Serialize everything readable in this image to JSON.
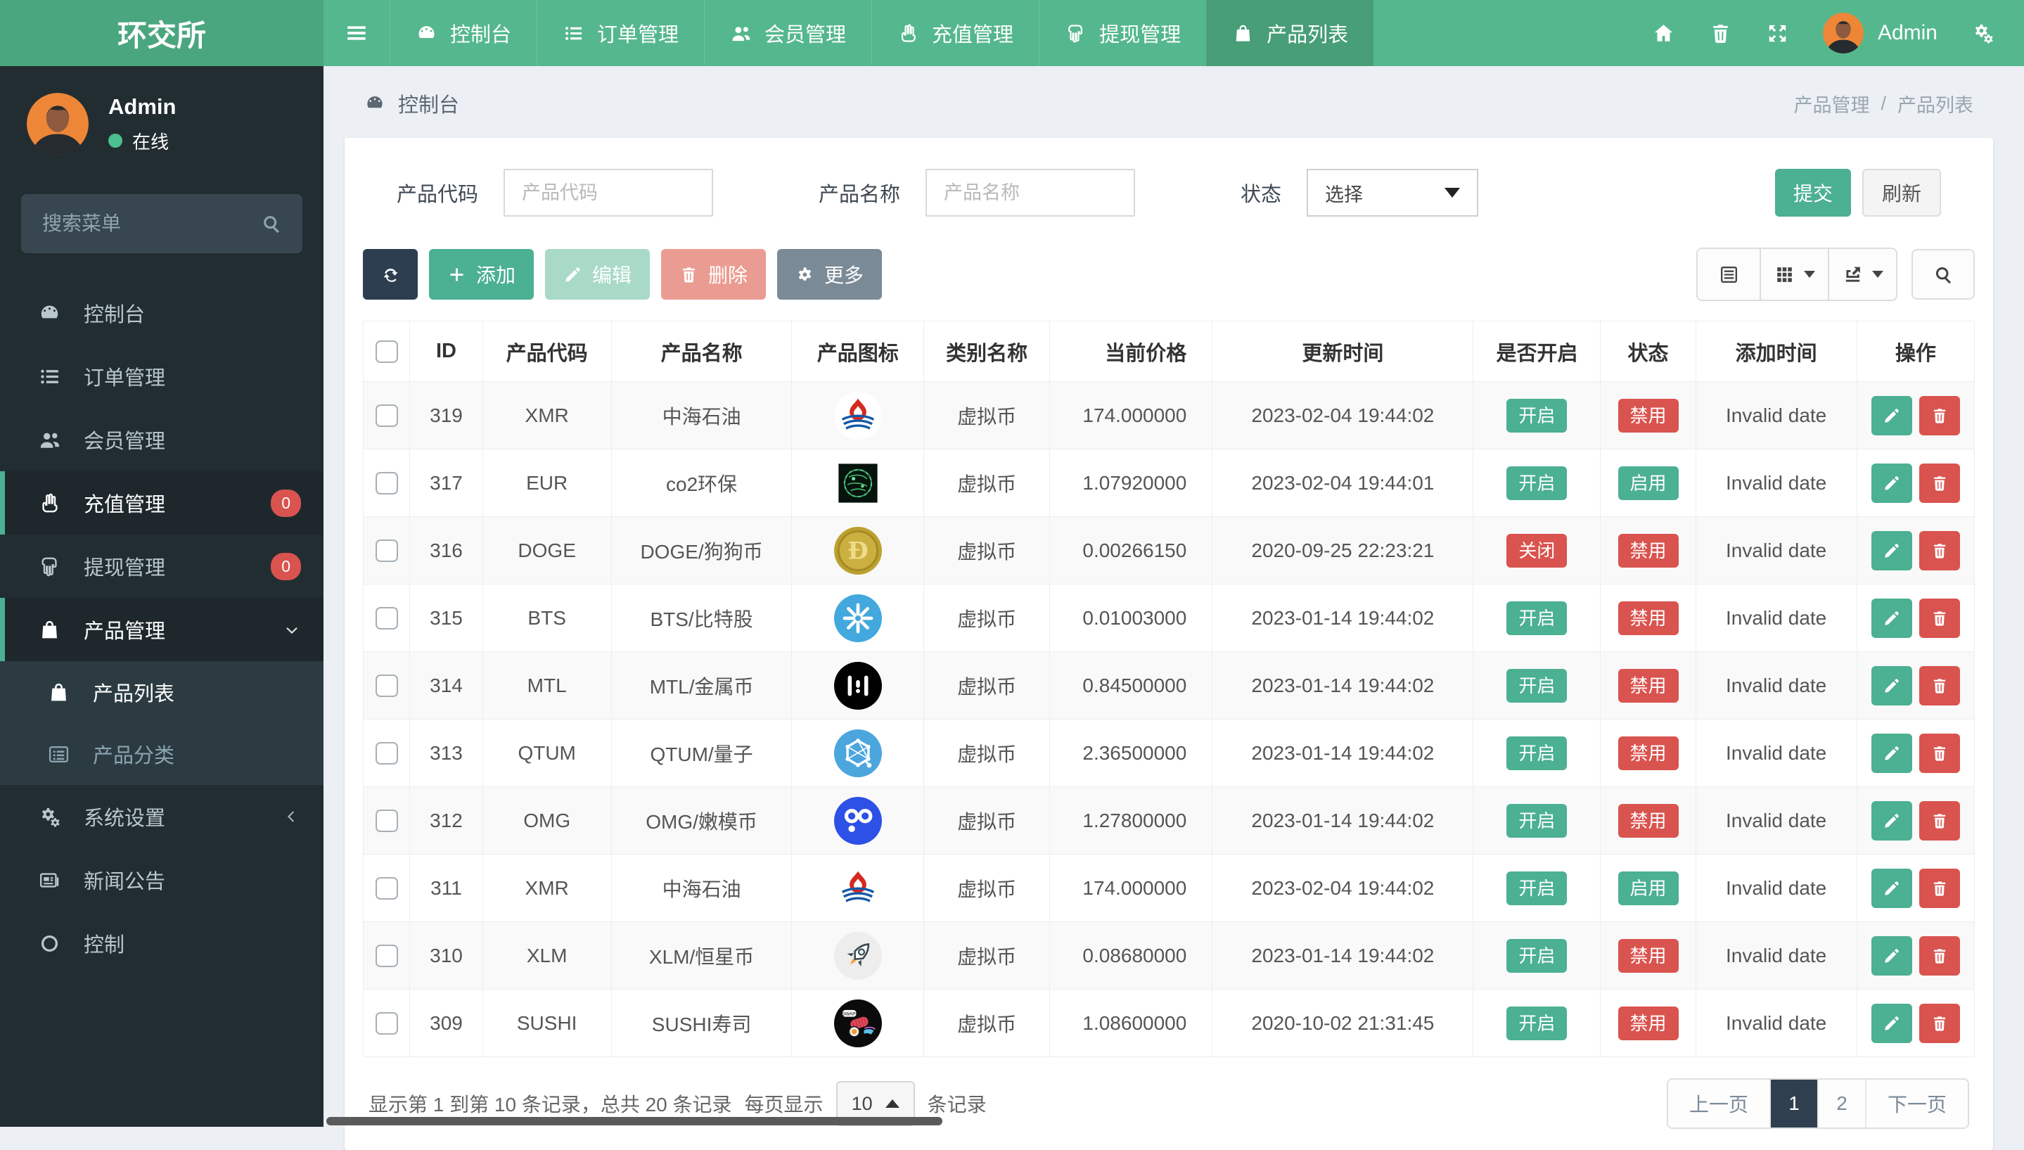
{
  "brand": {
    "title": "环交所"
  },
  "navbar": {
    "items": [
      {
        "key": "dashboard",
        "label": "控制台",
        "icon": "dashboard-icon",
        "active": false
      },
      {
        "key": "orders",
        "label": "订单管理",
        "icon": "order-list-icon",
        "active": false
      },
      {
        "key": "members",
        "label": "会员管理",
        "icon": "users-icon",
        "active": false
      },
      {
        "key": "recharge",
        "label": "充值管理",
        "icon": "hand-up-icon",
        "active": false
      },
      {
        "key": "withdraw",
        "label": "提现管理",
        "icon": "hand-down-icon",
        "active": false
      },
      {
        "key": "product-list",
        "label": "产品列表",
        "icon": "bag-icon",
        "active": true
      }
    ],
    "user_name": "Admin"
  },
  "sidebar": {
    "user": {
      "name": "Admin",
      "status": "在线"
    },
    "search_placeholder": "搜索菜单",
    "items": [
      {
        "key": "dashboard",
        "label": "控制台",
        "icon": "dashboard-icon"
      },
      {
        "key": "orders",
        "label": "订单管理",
        "icon": "order-list-icon"
      },
      {
        "key": "members",
        "label": "会员管理",
        "icon": "users-icon"
      },
      {
        "key": "recharge",
        "label": "充值管理",
        "icon": "hand-up-icon",
        "badge": "0",
        "highlighted": true
      },
      {
        "key": "withdraw",
        "label": "提现管理",
        "icon": "hand-down-icon",
        "badge": "0"
      },
      {
        "key": "product-manage",
        "label": "产品管理",
        "icon": "bag-icon",
        "active": true,
        "chevron": "down",
        "children": [
          {
            "key": "product-list",
            "label": "产品列表",
            "icon": "bag-icon",
            "active": true
          },
          {
            "key": "product-category",
            "label": "产品分类",
            "icon": "category-icon"
          }
        ]
      },
      {
        "key": "system-settings",
        "label": "系统设置",
        "icon": "gears-icon",
        "chevron": "left"
      },
      {
        "key": "news",
        "label": "新闻公告",
        "icon": "news-icon"
      },
      {
        "key": "control",
        "label": "控制",
        "icon": "circle-icon"
      }
    ]
  },
  "breadcrumb": {
    "section": "控制台",
    "path": [
      "产品管理",
      "产品列表"
    ],
    "separator": "/"
  },
  "filters": {
    "code": {
      "label": "产品代码",
      "placeholder": "产品代码",
      "value": ""
    },
    "name": {
      "label": "产品名称",
      "placeholder": "产品名称",
      "value": ""
    },
    "status": {
      "label": "状态",
      "value": "选择"
    },
    "submit_label": "提交",
    "refresh_label": "刷新"
  },
  "toolbar": {
    "add_label": "添加",
    "edit_label": "编辑",
    "delete_label": "删除",
    "more_label": "更多"
  },
  "table": {
    "columns": [
      "ID",
      "产品代码",
      "产品名称",
      "产品图标",
      "类别名称",
      "当前价格",
      "更新时间",
      "是否开启",
      "状态",
      "添加时间",
      "操作"
    ],
    "rows": [
      {
        "id": "319",
        "code": "XMR",
        "name": "中海石油",
        "icon": "cnooc-logo",
        "category": "虚拟币",
        "price": "174.000000",
        "updated": "2023-02-04 19:44:02",
        "open": {
          "label": "开启",
          "type": "success"
        },
        "status": {
          "label": "禁用",
          "type": "danger"
        },
        "added": "Invalid date"
      },
      {
        "id": "317",
        "code": "EUR",
        "name": "co2环保",
        "icon": "co2-globe",
        "category": "虚拟币",
        "price": "1.07920000",
        "updated": "2023-02-04 19:44:01",
        "open": {
          "label": "开启",
          "type": "success"
        },
        "status": {
          "label": "启用",
          "type": "success"
        },
        "added": "Invalid date"
      },
      {
        "id": "316",
        "code": "DOGE",
        "name": "DOGE/狗狗币",
        "icon": "doge-coin",
        "category": "虚拟币",
        "price": "0.00266150",
        "updated": "2020-09-25 22:23:21",
        "open": {
          "label": "关闭",
          "type": "danger"
        },
        "status": {
          "label": "禁用",
          "type": "danger"
        },
        "added": "Invalid date"
      },
      {
        "id": "315",
        "code": "BTS",
        "name": "BTS/比特股",
        "icon": "bts-logo",
        "category": "虚拟币",
        "price": "0.01003000",
        "updated": "2023-01-14 19:44:02",
        "open": {
          "label": "开启",
          "type": "success"
        },
        "status": {
          "label": "禁用",
          "type": "danger"
        },
        "added": "Invalid date"
      },
      {
        "id": "314",
        "code": "MTL",
        "name": "MTL/金属币",
        "icon": "mtl-logo",
        "category": "虚拟币",
        "price": "0.84500000",
        "updated": "2023-01-14 19:44:02",
        "open": {
          "label": "开启",
          "type": "success"
        },
        "status": {
          "label": "禁用",
          "type": "danger"
        },
        "added": "Invalid date"
      },
      {
        "id": "313",
        "code": "QTUM",
        "name": "QTUM/量子",
        "icon": "qtum-logo",
        "category": "虚拟币",
        "price": "2.36500000",
        "updated": "2023-01-14 19:44:02",
        "open": {
          "label": "开启",
          "type": "success"
        },
        "status": {
          "label": "禁用",
          "type": "danger"
        },
        "added": "Invalid date"
      },
      {
        "id": "312",
        "code": "OMG",
        "name": "OMG/嫩模币",
        "icon": "omg-logo",
        "category": "虚拟币",
        "price": "1.27800000",
        "updated": "2023-01-14 19:44:02",
        "open": {
          "label": "开启",
          "type": "success"
        },
        "status": {
          "label": "禁用",
          "type": "danger"
        },
        "added": "Invalid date"
      },
      {
        "id": "311",
        "code": "XMR",
        "name": "中海石油",
        "icon": "cnooc-logo",
        "category": "虚拟币",
        "price": "174.000000",
        "updated": "2023-02-04 19:44:02",
        "open": {
          "label": "开启",
          "type": "success"
        },
        "status": {
          "label": "启用",
          "type": "success"
        },
        "added": "Invalid date"
      },
      {
        "id": "310",
        "code": "XLM",
        "name": "XLM/恒星币",
        "icon": "xlm-rocket",
        "category": "虚拟币",
        "price": "0.08680000",
        "updated": "2023-01-14 19:44:02",
        "open": {
          "label": "开启",
          "type": "success"
        },
        "status": {
          "label": "禁用",
          "type": "danger"
        },
        "added": "Invalid date"
      },
      {
        "id": "309",
        "code": "SUSHI",
        "name": "SUSHI寿司",
        "icon": "sushi-art",
        "category": "虚拟币",
        "price": "1.08600000",
        "updated": "2020-10-02 21:31:45",
        "open": {
          "label": "开启",
          "type": "success"
        },
        "status": {
          "label": "禁用",
          "type": "danger"
        },
        "added": "Invalid date"
      }
    ]
  },
  "footer": {
    "info": "显示第 1 到第 10 条记录，总共 20 条记录",
    "per_page_prefix": "每页显示",
    "page_size": "10",
    "per_page_suffix": "条记录",
    "pagination": {
      "prev": "上一页",
      "pages": [
        "1",
        "2"
      ],
      "active": "1",
      "next": "下一页"
    }
  },
  "colors": {
    "accent": "#4cb092",
    "danger": "#d9534f",
    "navbar": "#55b78e",
    "dark": "#2c3e50"
  }
}
